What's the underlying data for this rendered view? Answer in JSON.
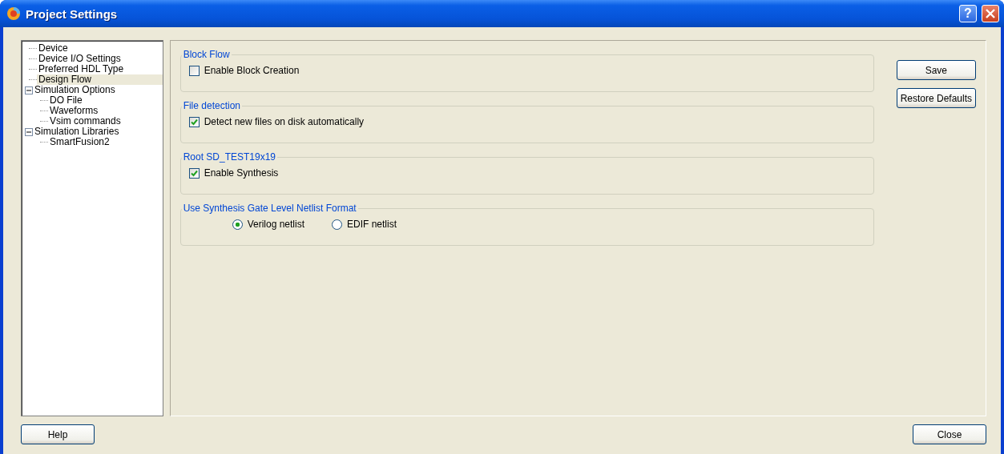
{
  "window": {
    "title": "Project Settings",
    "help_glyph": "?"
  },
  "tree": [
    {
      "label": "Device",
      "selected": false
    },
    {
      "label": "Device I/O Settings",
      "selected": false
    },
    {
      "label": "Preferred HDL Type",
      "selected": false
    },
    {
      "label": "Design Flow",
      "selected": true
    },
    {
      "label": "Simulation Options",
      "selected": false,
      "expanded": true,
      "children": [
        {
          "label": "DO File",
          "selected": false
        },
        {
          "label": "Waveforms",
          "selected": false
        },
        {
          "label": "Vsim commands",
          "selected": false
        }
      ]
    },
    {
      "label": "Simulation Libraries",
      "selected": false,
      "expanded": true,
      "children": [
        {
          "label": "SmartFusion2",
          "selected": false
        }
      ]
    }
  ],
  "groups": [
    {
      "title": "Block Flow",
      "kind": "checkbox",
      "options": [
        {
          "label": "Enable Block Creation",
          "checked": false
        }
      ]
    },
    {
      "title": "File detection",
      "kind": "checkbox",
      "options": [
        {
          "label": "Detect new files on disk automatically",
          "checked": true
        }
      ]
    },
    {
      "title": "Root SD_TEST19x19",
      "kind": "checkbox",
      "options": [
        {
          "label": "Enable Synthesis",
          "checked": true
        }
      ]
    },
    {
      "title": "Use Synthesis Gate Level Netlist Format",
      "kind": "radio",
      "options": [
        {
          "label": "Verilog netlist",
          "selected": true
        },
        {
          "label": "EDIF netlist",
          "selected": false
        }
      ]
    }
  ],
  "side_buttons": [
    "Save",
    "Restore Defaults"
  ],
  "footer": {
    "help": "Help",
    "close": "Close"
  }
}
